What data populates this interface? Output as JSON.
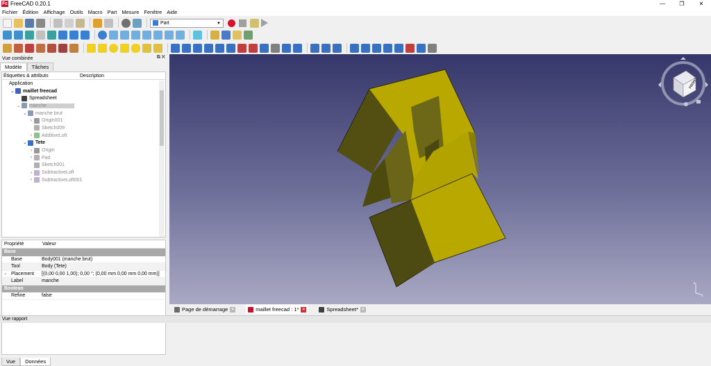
{
  "window": {
    "title": "FreeCAD 0.20.1",
    "app_icon": "Fc",
    "min": "—",
    "max": "❐",
    "close": "✕"
  },
  "menu": [
    "Fichier",
    "Édition",
    "Affichage",
    "Outils",
    "Macro",
    "Part",
    "Mesure",
    "Fenêtre",
    "Aide"
  ],
  "toolbar": {
    "workbench": "Part"
  },
  "left_panel": {
    "title": "Vue combinée",
    "header_buttons": "⧉ ✕",
    "tabs": [
      "Modèle",
      "Tâches"
    ],
    "tree_columns": [
      "Étiquettes & attributs",
      "Description"
    ],
    "tree": [
      {
        "label": "Application",
        "indent": 0,
        "style": "normal",
        "exp": "",
        "icon": ""
      },
      {
        "label": "maillet freecad",
        "indent": 1,
        "style": "bold",
        "exp": "⌄",
        "icon": "#4060c0"
      },
      {
        "label": "Spreadsheet",
        "indent": 2,
        "style": "normal",
        "exp": "",
        "icon": "#404040"
      },
      {
        "label": "manche",
        "indent": 2,
        "style": "gray-sel",
        "exp": "⌄",
        "icon": "#8a9ab8"
      },
      {
        "label": "manche brut",
        "indent": 3,
        "style": "gray",
        "exp": "⌄",
        "icon": "#8a9ab8"
      },
      {
        "label": "Origin001",
        "indent": 4,
        "style": "gray",
        "exp": "›",
        "icon": "#999999"
      },
      {
        "label": "Sketch009",
        "indent": 4,
        "style": "gray",
        "exp": "",
        "icon": "#b0b0b0"
      },
      {
        "label": "AdditiveLoft",
        "indent": 4,
        "style": "gray",
        "exp": "›",
        "icon": "#8cc08c"
      },
      {
        "label": "Tete",
        "indent": 3,
        "style": "bold",
        "exp": "⌄",
        "icon": "#3a6fc8"
      },
      {
        "label": "Origin",
        "indent": 4,
        "style": "gray",
        "exp": "›",
        "icon": "#999999"
      },
      {
        "label": "Pad",
        "indent": 4,
        "style": "gray",
        "exp": "›",
        "icon": "#b0b0b0"
      },
      {
        "label": "Sketch001",
        "indent": 4,
        "style": "gray",
        "exp": "",
        "icon": "#b0b0b0"
      },
      {
        "label": "SubtractiveLoft",
        "indent": 4,
        "style": "gray",
        "exp": "›",
        "icon": "#c0b0d0"
      },
      {
        "label": "SubtractiveLoft001",
        "indent": 4,
        "style": "gray",
        "exp": "›",
        "icon": "#c0b0d0"
      }
    ],
    "property_columns": [
      "Propriété",
      "Valeur"
    ],
    "properties": [
      {
        "group": "Base",
        "rows": [
          {
            "key": "Base",
            "value": "Body001 (manche brut)",
            "exp": ""
          },
          {
            "key": "Tool",
            "value": "Body (Tete)",
            "exp": ""
          },
          {
            "key": "Placement",
            "value": "[(0,00 0,00 1,00); 0,00 °; (0,00 mm  0,00 mm  0,00 mm)]",
            "exp": "›"
          },
          {
            "key": "Label",
            "value": "manche",
            "exp": ""
          }
        ]
      },
      {
        "group": "Boolean",
        "rows": [
          {
            "key": "Refine",
            "value": "false",
            "exp": ""
          }
        ]
      }
    ],
    "bottom_tabs": [
      "Vue",
      "Données"
    ]
  },
  "viewport": {
    "navcube_face": "FRONT",
    "axis_z": "z",
    "axis_x": "x",
    "solid_color": "#b8a800"
  },
  "doc_tabs": [
    {
      "label": "Page de démarrage",
      "close": "✕",
      "icon": "#6a6a6a"
    },
    {
      "label": "maillet freecad : 1*",
      "close": "✕",
      "icon": "#c8102e"
    },
    {
      "label": "Spreadsheet*",
      "close": "✕",
      "icon": "#404040"
    }
  ],
  "status": "Vue rapport"
}
